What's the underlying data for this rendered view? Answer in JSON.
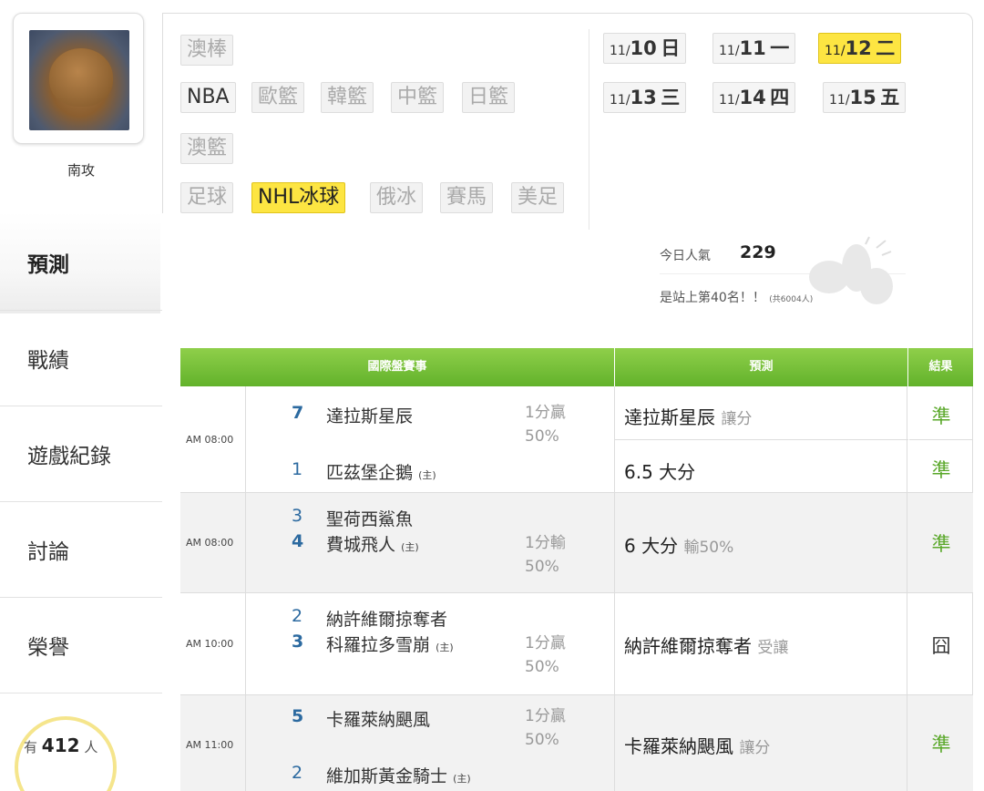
{
  "user": {
    "name": "南攻"
  },
  "nav": {
    "items": [
      {
        "label": "預測",
        "active": true
      },
      {
        "label": "戰績"
      },
      {
        "label": "遊戲紀錄"
      },
      {
        "label": "討論"
      },
      {
        "label": "榮譽"
      }
    ]
  },
  "popularity_badge": {
    "prefix": "有",
    "count": "412",
    "suffix": "人"
  },
  "categories": [
    "澳棒",
    "NBA",
    "歐籃",
    "韓籃",
    "中籃",
    "日籃",
    "澳籃",
    "足球",
    "NHL冰球",
    "俄冰",
    "賽馬",
    "美足"
  ],
  "active_category": "NHL冰球",
  "dates": [
    {
      "md": "11/",
      "day": "10",
      "dow": "日"
    },
    {
      "md": "11/",
      "day": "11",
      "dow": "一"
    },
    {
      "md": "11/",
      "day": "12",
      "dow": "二",
      "active": true
    },
    {
      "md": "11/",
      "day": "13",
      "dow": "三"
    },
    {
      "md": "11/",
      "day": "14",
      "dow": "四"
    },
    {
      "md": "11/",
      "day": "15",
      "dow": "五"
    }
  ],
  "stats": {
    "today_label": "今日人氣",
    "today_value": "229",
    "rank_text": "是站上第40名！！",
    "rank_total": "(共6004人)"
  },
  "table": {
    "headers": {
      "match": "國際盤賽事",
      "prediction": "預測",
      "result": "結果"
    },
    "rows": [
      {
        "time": "AM 08:00",
        "team1_rank": "7",
        "team1": "達拉斯星辰",
        "team2_rank": "1",
        "team2": "匹茲堡企鵝",
        "host": "(主)",
        "spread": "1分贏",
        "spread_pct": "50%",
        "pred1": "達拉斯星辰",
        "pred1_sub": "讓分",
        "result1": "準",
        "pred2": "6.5 大分",
        "pred2_sub": "",
        "result2": "準"
      },
      {
        "time": "AM 08:00",
        "team1_rank": "3",
        "team1": "聖荷西鯊魚",
        "team2_rank": "4",
        "team2": "費城飛人",
        "host": "(主)",
        "spread": "1分輸",
        "spread_pct": "50%",
        "pred1": "6 大分",
        "pred1_sub": "輸50%",
        "result1": "準"
      },
      {
        "time": "AM 10:00",
        "team1_rank": "2",
        "team1": "納許維爾掠奪者",
        "team2_rank": "3",
        "team2": "科羅拉多雪崩",
        "host": "(主)",
        "spread": "1分贏",
        "spread_pct": "50%",
        "pred1": "納許維爾掠奪者",
        "pred1_sub": "受讓",
        "result1": "囧"
      },
      {
        "time": "AM 11:00",
        "team1_rank": "5",
        "team1": "卡羅萊納颶風",
        "team2_rank": "2",
        "team2": "維加斯黃金騎士",
        "host": "(主)",
        "spread": "1分贏",
        "spread_pct": "50%",
        "pred1": "卡羅萊納颶風",
        "pred1_sub": "讓分",
        "result1": "準"
      }
    ]
  }
}
